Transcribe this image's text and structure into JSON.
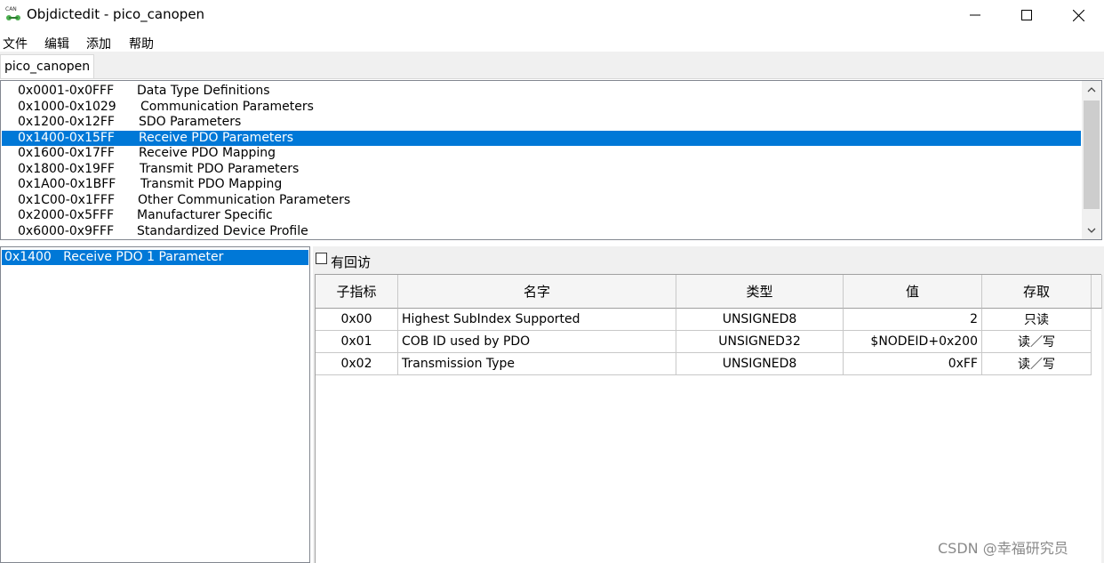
{
  "window": {
    "title": "Objdictedit - pico_canopen",
    "icon_label": "CAN",
    "minimize_icon": "minimize-icon",
    "maximize_icon": "maximize-icon",
    "close_icon": "close-icon"
  },
  "menu": [
    "文件",
    "编辑",
    "添加",
    "帮助"
  ],
  "tab": {
    "label": "pico_canopen"
  },
  "index_ranges": [
    {
      "range": "0x0001-0x0FFF",
      "desc": "Data Type Definitions",
      "selected": false
    },
    {
      "range": "0x1000-0x1029",
      "desc": "Communication Parameters",
      "selected": false
    },
    {
      "range": "0x1200-0x12FF",
      "desc": "SDO Parameters",
      "selected": false
    },
    {
      "range": "0x1400-0x15FF",
      "desc": "Receive PDO Parameters",
      "selected": true
    },
    {
      "range": "0x1600-0x17FF",
      "desc": "Receive PDO Mapping",
      "selected": false
    },
    {
      "range": "0x1800-0x19FF",
      "desc": "Transmit PDO Parameters",
      "selected": false
    },
    {
      "range": "0x1A00-0x1BFF",
      "desc": "Transmit PDO Mapping",
      "selected": false
    },
    {
      "range": "0x1C00-0x1FFF",
      "desc": "Other Communication Parameters",
      "selected": false
    },
    {
      "range": "0x2000-0x5FFF",
      "desc": "Manufacturer Specific",
      "selected": false
    },
    {
      "range": "0x6000-0x9FFF",
      "desc": "Standardized Device Profile",
      "selected": false
    }
  ],
  "index_list": {
    "selected_item": "0x1400   Receive PDO 1 Parameter"
  },
  "callback_checkbox": {
    "label": "有回访",
    "checked": false
  },
  "table": {
    "headers": [
      "子指标",
      "名字",
      "类型",
      "值",
      "存取"
    ],
    "rows": [
      [
        "0x00",
        "Highest SubIndex Supported",
        "UNSIGNED8",
        "2",
        "只读"
      ],
      [
        "0x01",
        "COB ID used by PDO",
        "UNSIGNED32",
        "$NODEID+0x200",
        "读／写"
      ],
      [
        "0x02",
        "Transmission Type",
        "UNSIGNED8",
        "0xFF",
        "读／写"
      ]
    ]
  },
  "watermark": "CSDN @幸福研究员",
  "colors": {
    "selection": "#0078d7",
    "panel_bg": "#f0f0f0"
  }
}
